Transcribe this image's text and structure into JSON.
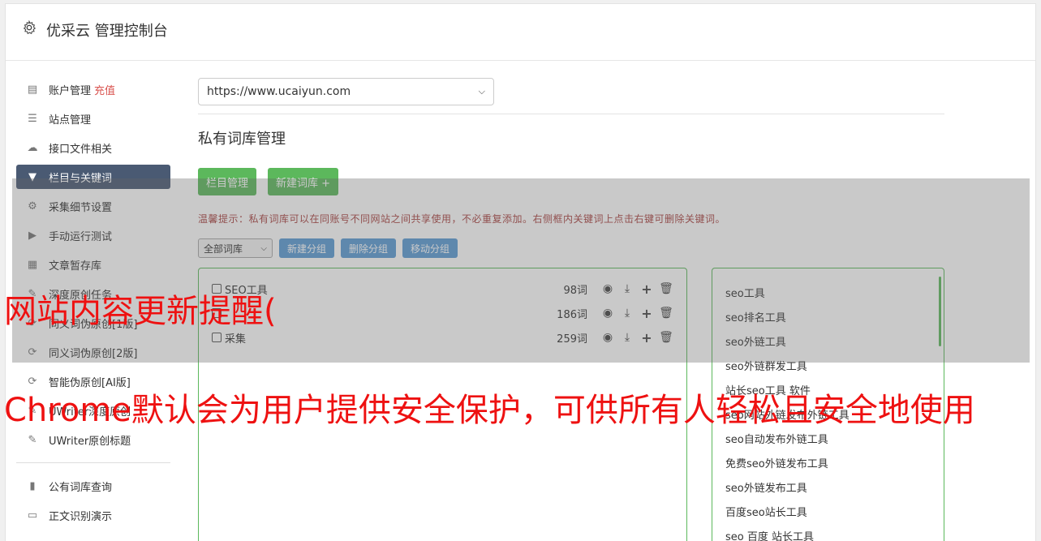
{
  "app": {
    "title": "优采云 管理控制台"
  },
  "sidebar": {
    "items": [
      {
        "label": "账户管理",
        "extra": "充值",
        "icon": "bar-chart-icon"
      },
      {
        "label": "站点管理",
        "icon": "server-icon"
      },
      {
        "label": "接口文件相关",
        "icon": "cloud-upload-icon"
      },
      {
        "label": "栏目与关键词",
        "icon": "filter-icon",
        "active": true
      },
      {
        "label": "采集细节设置",
        "icon": "cogs-icon"
      },
      {
        "label": "手动运行测试",
        "icon": "play-icon"
      },
      {
        "label": "文章暂存库",
        "icon": "database-icon"
      },
      {
        "label": "深度原创任务",
        "icon": "edit-icon"
      },
      {
        "label": "同义词伪原创[1版]",
        "icon": "refresh-icon"
      },
      {
        "label": "同义词伪原创[2版]",
        "icon": "refresh-icon"
      },
      {
        "label": "智能伪原创[AI版]",
        "icon": "refresh-icon"
      },
      {
        "label": "UWriter深度原创",
        "icon": "edit-icon"
      },
      {
        "label": "UWriter原创标题",
        "icon": "edit-icon"
      }
    ],
    "items2": [
      {
        "label": "公有词库查询",
        "icon": "book-icon"
      },
      {
        "label": "正文识别演示",
        "icon": "monitor-icon"
      }
    ]
  },
  "main": {
    "site_select": "https://www.ucaiyun.com",
    "heading": "私有词库管理",
    "btn_columns": "栏目管理",
    "btn_new_lib": "新建词库 +",
    "tip": "温馨提示：私有词库可以在同账号不同网站之间共享使用，不必重复添加。右侧框内关键词上点击右键可删除关键词。",
    "lib_select": "全部词库",
    "btn_new_group": "新建分组",
    "btn_delete_group": "删除分组",
    "btn_move_group": "移动分组",
    "groups": [
      {
        "name": "SEO工具",
        "count": "98词"
      },
      {
        "name": "",
        "count": "186词"
      },
      {
        "name": "采集",
        "count": "259词"
      }
    ],
    "keywords": [
      "seo工具",
      "seo排名工具",
      "seo外链工具",
      "seo外链群发工具",
      "站长seo工具 软件",
      "seo网站外链发布外链工具",
      "seo自动发布外链工具",
      "免费seo外链发布工具",
      "seo外链发布工具",
      "百度seo站长工具",
      "seo 百度 站长工具"
    ]
  },
  "overlay": {
    "line1": "网站内容更新提醒(",
    "line2": "Chrome默认会为用户提供安全保护，可供所有人轻松且安全地使用"
  },
  "colors": {
    "accent_green": "#5cb85c",
    "accent_blue": "#5b9bd5",
    "active_nav": "#4a5a73",
    "overlay_text": "#ee1111"
  }
}
